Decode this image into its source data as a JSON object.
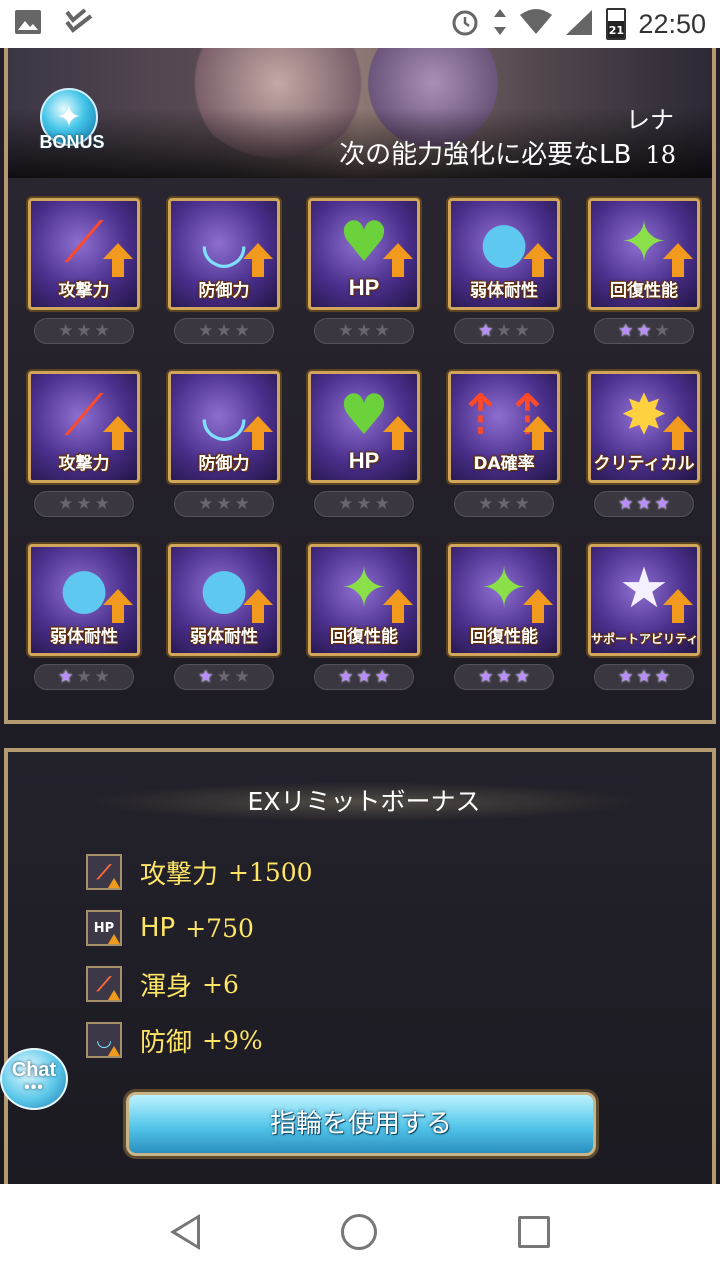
{
  "status_bar": {
    "time": "22:50",
    "battery_level": "21",
    "icons": [
      "gallery-icon",
      "check-icon",
      "alarm-icon",
      "data-arrows-icon",
      "wifi-icon",
      "signal-icon",
      "battery-charging-icon"
    ]
  },
  "header": {
    "bonus_label": "BONUS",
    "character_name": "レナ",
    "lb_requirement_label": "次の能力強化に必要なLB",
    "lb_requirement_value": "18"
  },
  "skills": [
    {
      "label": "攻撃力",
      "icon": "sword-icon",
      "stars": 0
    },
    {
      "label": "防御力",
      "icon": "shield-icon",
      "stars": 0
    },
    {
      "label": "HP",
      "icon": "heart-icon",
      "stars": 0
    },
    {
      "label": "弱体耐性",
      "icon": "debuff-resist-icon",
      "stars": 1
    },
    {
      "label": "回復性能",
      "icon": "sparkle-icon",
      "stars": 2
    },
    {
      "label": "攻撃力",
      "icon": "sword-icon",
      "stars": 0
    },
    {
      "label": "防御力",
      "icon": "shield-icon",
      "stars": 0
    },
    {
      "label": "HP",
      "icon": "heart-icon",
      "stars": 0
    },
    {
      "label": "DA確率",
      "icon": "double-attack-icon",
      "stars": 0
    },
    {
      "label": "クリティカル",
      "icon": "critical-burst-icon",
      "stars": 3
    },
    {
      "label": "弱体耐性",
      "icon": "debuff-resist-icon",
      "stars": 1
    },
    {
      "label": "弱体耐性",
      "icon": "debuff-resist-icon",
      "stars": 1
    },
    {
      "label": "回復性能",
      "icon": "sparkle-icon",
      "stars": 3
    },
    {
      "label": "回復性能",
      "icon": "sparkle-icon",
      "stars": 3
    },
    {
      "label": "サポートアビリティ",
      "icon": "support-star-icon",
      "stars": 3
    }
  ],
  "ex_bonus": {
    "title": "EXリミットボーナス",
    "items": [
      {
        "name": "攻撃力",
        "value": "+1500",
        "icon": "attack-up-icon"
      },
      {
        "name": "HP",
        "value": "+750",
        "icon": "hp-up-icon"
      },
      {
        "name": "渾身",
        "value": "+6",
        "icon": "stamina-up-icon"
      },
      {
        "name": "防御",
        "value": "+9%",
        "icon": "defense-up-icon"
      }
    ]
  },
  "chat_button_label": "Chat",
  "ring_button_label": "指輪を使用する",
  "colors": {
    "frame_gold": "#d1a65a",
    "tile_purple": "#4a2f8c",
    "star_on": "#b98cff",
    "bonus_text": "#ffe566",
    "button_cyan": "#54c6ea"
  }
}
